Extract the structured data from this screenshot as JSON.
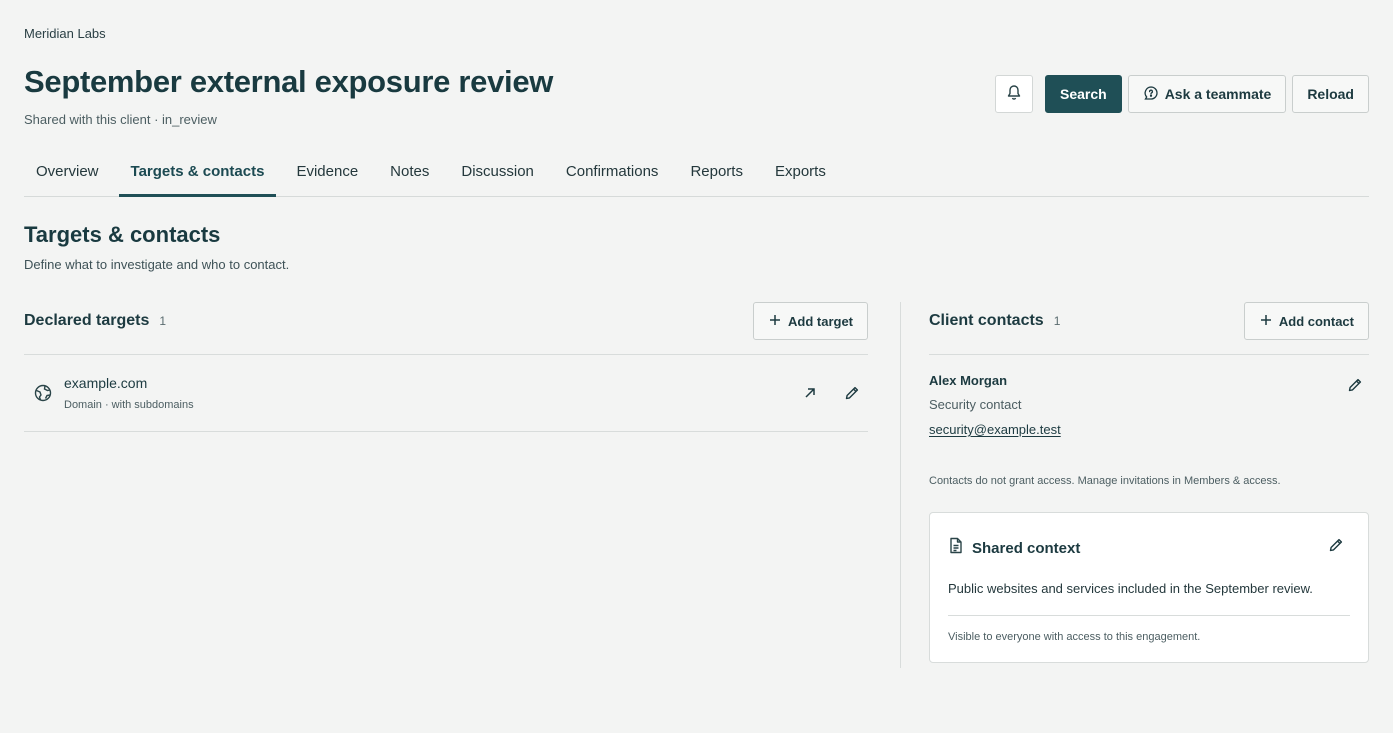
{
  "header": {
    "org": "Meridian Labs",
    "title": "September external exposure review",
    "subtitle": "Shared with this client · in_review",
    "actions": {
      "notifications_icon": "bell-icon",
      "search_label": "Search",
      "ask_label": "Ask a teammate",
      "reload_label": "Reload"
    }
  },
  "tabs": [
    {
      "label": "Overview",
      "active": false
    },
    {
      "label": "Targets & contacts",
      "active": true
    },
    {
      "label": "Evidence",
      "active": false
    },
    {
      "label": "Notes",
      "active": false
    },
    {
      "label": "Discussion",
      "active": false
    },
    {
      "label": "Confirmations",
      "active": false
    },
    {
      "label": "Reports",
      "active": false
    },
    {
      "label": "Exports",
      "active": false
    }
  ],
  "section": {
    "title": "Targets & contacts",
    "description": "Define what to investigate and who to contact."
  },
  "targets": {
    "title": "Declared targets",
    "count": "1",
    "add_label": "Add target",
    "items": [
      {
        "name": "example.com",
        "meta": "Domain · with subdomains",
        "icon": "globe-icon"
      }
    ]
  },
  "contacts": {
    "title": "Client contacts",
    "count": "1",
    "add_label": "Add contact",
    "items": [
      {
        "name": "Alex Morgan",
        "role": "Security contact",
        "email": "security@example.test"
      }
    ],
    "note": "Contacts do not grant access. Manage invitations in Members & access."
  },
  "shared_context": {
    "title": "Shared context",
    "body": "Public websites and services included in the September review.",
    "footer": "Visible to everyone with access to this engagement."
  },
  "colors": {
    "accent": "#1f4f56",
    "background": "#f3f4f3",
    "text": "#193a40"
  }
}
